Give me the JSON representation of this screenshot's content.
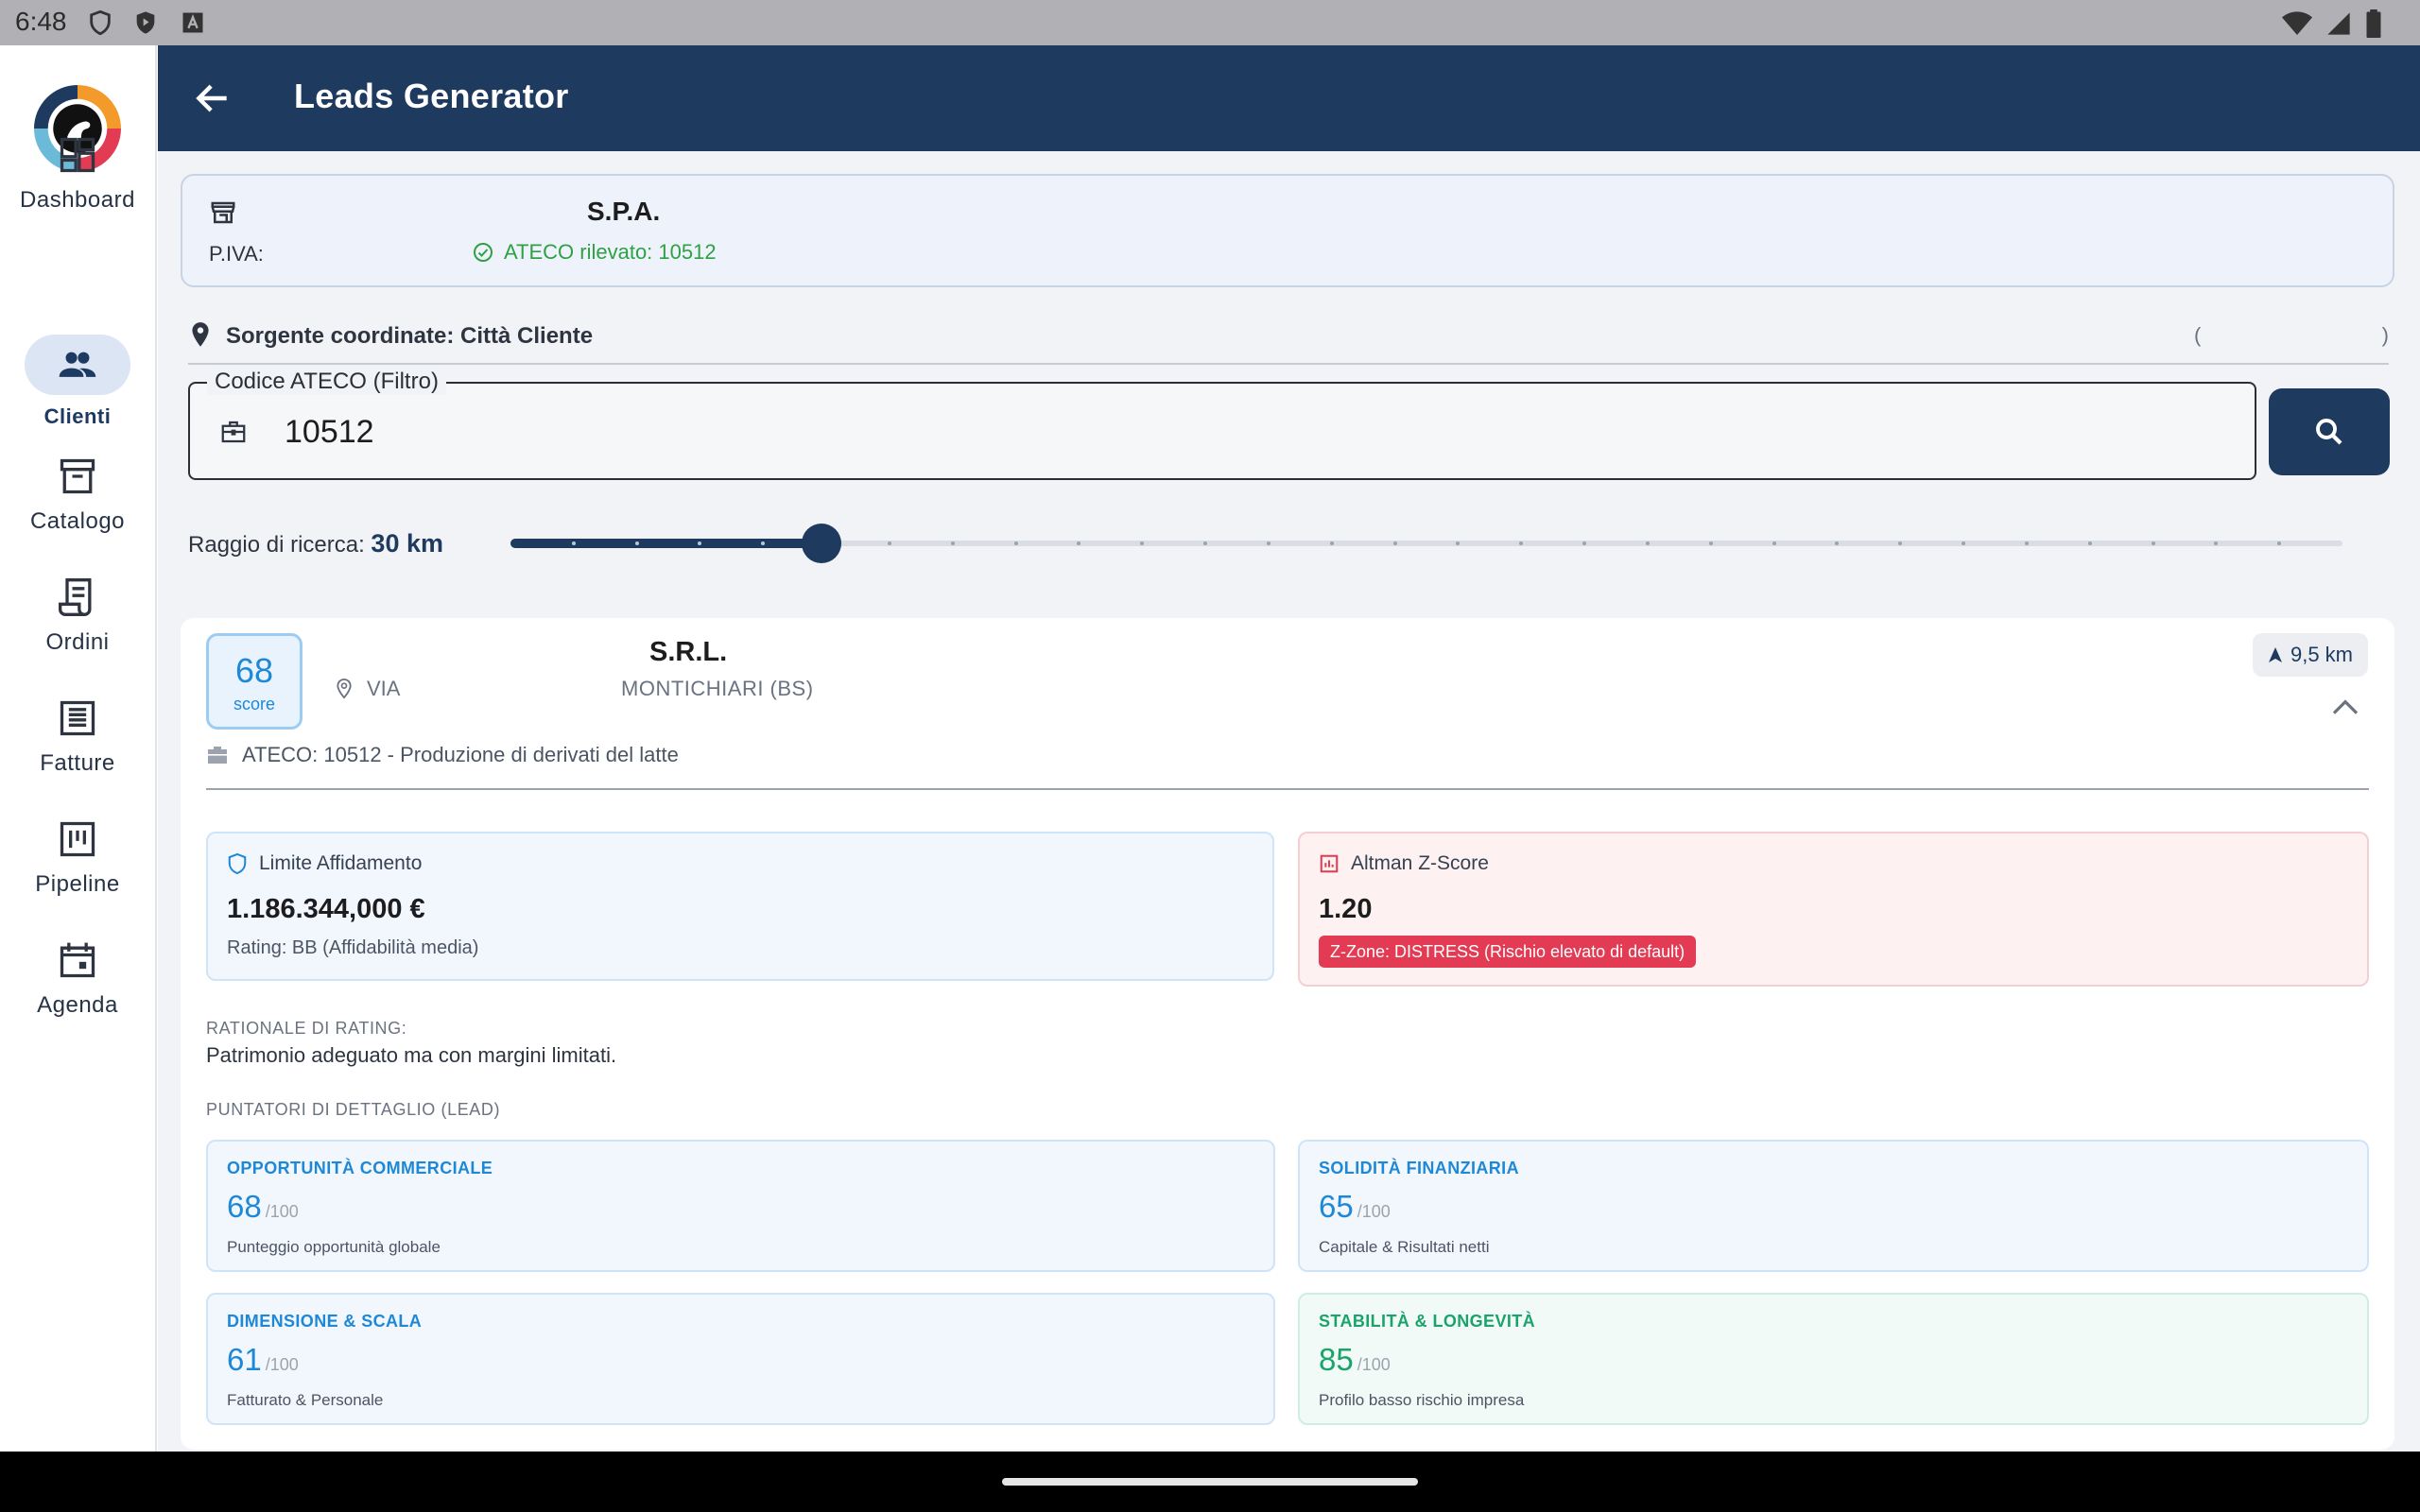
{
  "status_bar": {
    "time": "6:48",
    "left_icons": [
      "shield-icon",
      "play-protect-icon",
      "keyboard-a-icon"
    ],
    "right_icons": [
      "wifi-icon",
      "signal-icon",
      "battery-icon"
    ]
  },
  "rail": {
    "items": [
      {
        "label": "Dashboard",
        "icon": "dashboard-icon",
        "active": false
      },
      {
        "label": "Clienti",
        "icon": "people-icon",
        "active": true
      },
      {
        "label": "Catalogo",
        "icon": "archive-icon",
        "active": false
      },
      {
        "label": "Ordini",
        "icon": "receipt-icon",
        "active": false
      },
      {
        "label": "Fatture",
        "icon": "list-alt-icon",
        "active": false
      },
      {
        "label": "Pipeline",
        "icon": "kanban-icon",
        "active": false
      },
      {
        "label": "Agenda",
        "icon": "calendar-icon",
        "active": false
      }
    ]
  },
  "appbar": {
    "title": "Leads Generator"
  },
  "company": {
    "name": "S.P.A.",
    "piva_label": "P.IVA:",
    "ateco_detected": "ATECO rilevato: 10512"
  },
  "source": {
    "label": "Sorgente coordinate: Città Cliente",
    "paren_open": "(",
    "paren_close": ")"
  },
  "filter": {
    "label": "Codice ATECO (Filtro)",
    "value": "10512"
  },
  "radius": {
    "label": "Raggio di ricerca:",
    "value_text": "30 km",
    "fraction": 0.17
  },
  "lead": {
    "score": "68",
    "score_label": "score",
    "name": "S.R.L.",
    "address": "VIA",
    "city": "MONTICHIARI (BS)",
    "distance": "9,5 km",
    "ateco": "ATECO: 10512 - Produzione di derivati del latte",
    "limit": {
      "title": "Limite Affidamento",
      "value": "1.186.344,000 €",
      "rating": "Rating: BB (Affidabilità media)"
    },
    "altman": {
      "title": "Altman Z-Score",
      "value": "1.20",
      "zone": "Z-Zone: DISTRESS (Rischio elevato di default)"
    },
    "rationale_title": "RATIONALE DI RATING:",
    "rationale": "Patrimonio adeguato ma con margini limitati.",
    "details_title": "PUNTATORI DI DETTAGLIO (LEAD)",
    "metrics": [
      {
        "title": "OPPORTUNITÀ COMMERCIALE",
        "value": "68",
        "max": "/100",
        "desc": "Punteggio opportunità globale",
        "color": "#1e88d6"
      },
      {
        "title": "SOLIDITÀ FINANZIARIA",
        "value": "65",
        "max": "/100",
        "desc": "Capitale & Risultati netti",
        "color": "#1e88d6"
      },
      {
        "title": "DIMENSIONE & SCALA",
        "value": "61",
        "max": "/100",
        "desc": "Fatturato & Personale",
        "color": "#1e88d6"
      },
      {
        "title": "STABILITÀ & LONGEVITÀ",
        "value": "85",
        "max": "/100",
        "desc": "Profilo basso rischio impresa",
        "color": "#1aa36b"
      }
    ]
  }
}
